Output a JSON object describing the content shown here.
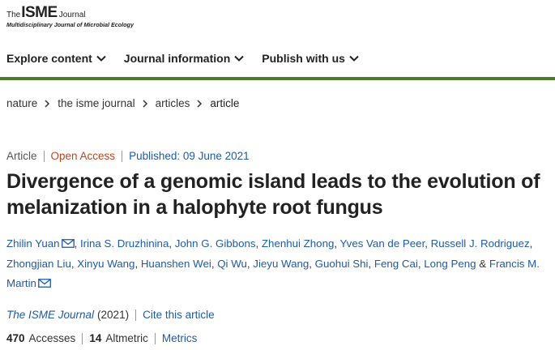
{
  "logo": {
    "the": "The",
    "name": "ISME",
    "journal": "Journal",
    "subtitle": "Multidisciplinary Journal of Microbial Ecology"
  },
  "nav": {
    "items": [
      {
        "label": "Explore content"
      },
      {
        "label": "Journal information"
      },
      {
        "label": "Publish with us"
      }
    ]
  },
  "breadcrumb": {
    "items": [
      "nature",
      "the isme journal",
      "articles",
      "article"
    ]
  },
  "article": {
    "type": "Article",
    "access": "Open Access",
    "published": "Published: 09 June 2021",
    "title": "Divergence of a genomic island leads to the evolution of melanization in a halophyte root fungus",
    "authors": [
      "Zhilin Yuan",
      "Irina S. Druzhinina",
      "John G. Gibbons",
      "Zhenhui Zhong",
      "Yves Van de Peer",
      "Russell J. Rodriguez",
      "Zhongjian Liu",
      "Xinyu Wang",
      "Huanshen Wei",
      "Qi Wu",
      "Jieyu Wang",
      "Guohui Shi",
      "Feng Cai",
      "Long Peng",
      "Francis M. Martin"
    ],
    "separators": {
      "comma": ", ",
      "and": " & "
    },
    "journal": "The ISME Journal",
    "year": "(2021)",
    "cite": "Cite this article"
  },
  "metrics": {
    "accesses_count": "470",
    "accesses_label": "Accesses",
    "altmetric_count": "14",
    "altmetric_label": "Altmetric",
    "metrics_link": "Metrics"
  },
  "colors": {
    "link": "#1e5ba8",
    "open_access": "#b8481e",
    "divider_bar": "#4a7a2a"
  }
}
